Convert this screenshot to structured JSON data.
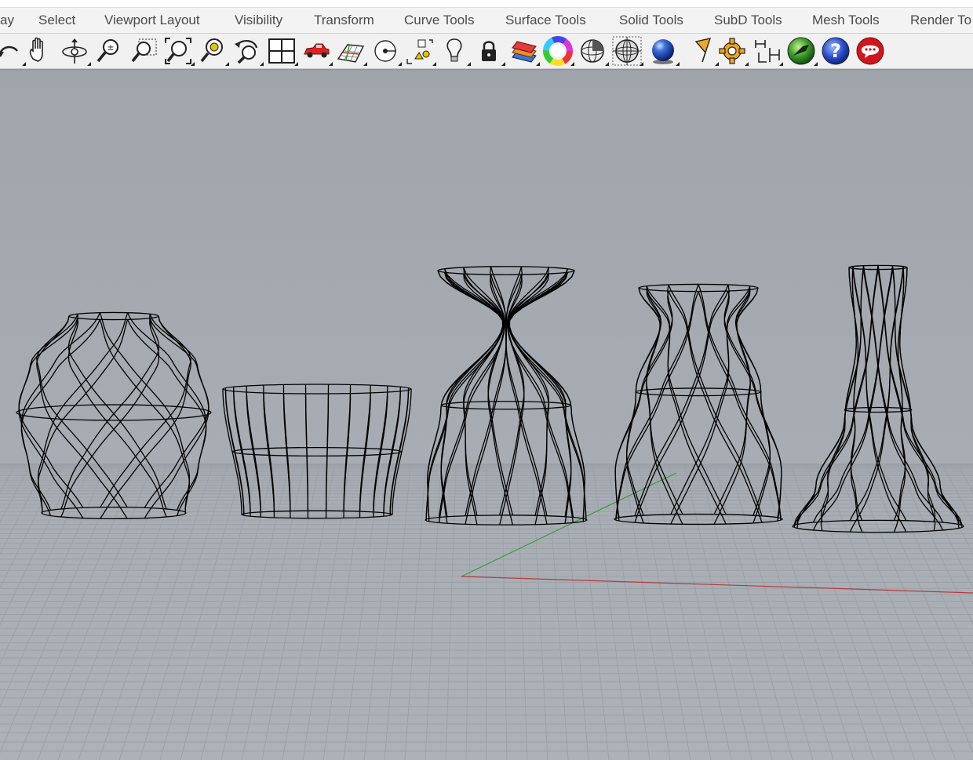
{
  "menu_tabs": [
    {
      "label": "ay"
    },
    {
      "label": "Select"
    },
    {
      "label": "Viewport Layout"
    },
    {
      "label": "Visibility"
    },
    {
      "label": "Transform"
    },
    {
      "label": "Curve Tools"
    },
    {
      "label": "Surface Tools"
    },
    {
      "label": "Solid Tools"
    },
    {
      "label": "SubD Tools"
    },
    {
      "label": "Mesh Tools"
    },
    {
      "label": "Render To"
    }
  ],
  "toolbar_icons": [
    "undo-icon",
    "pan-hand-icon",
    "rotate-view-icon",
    "zoom-in-out-icon",
    "zoom-window-icon",
    "zoom-extents-icon",
    "zoom-selected-icon",
    "undo-view-icon",
    "four-viewports-icon",
    "named-views-car-icon",
    "construction-plane-icon",
    "osnap-point-icon",
    "select-filter-icon",
    "light-bulb-icon",
    "lock-icon",
    "layers-icon",
    "color-wheel-icon",
    "wireframe-sphere-icon",
    "shaded-sphere-icon",
    "rendered-sphere-icon",
    "render-icon",
    "options-gear-icon",
    "dimension-icon",
    "grasshopper-icon",
    "help-icon",
    "chat-support-icon"
  ],
  "colors": {
    "viewport_background": "#a4a9b0",
    "grid_line": "#9aa0a7",
    "x_axis": "#b23c3c",
    "y_axis": "#3c9a3c",
    "wireframe": "#000000"
  },
  "viewport": {
    "display_mode": "Wireframe",
    "objects": [
      "vase-bulb-twisted",
      "basket-tapered",
      "hourglass-vase",
      "flared-vase",
      "tall-flared-vase"
    ]
  }
}
